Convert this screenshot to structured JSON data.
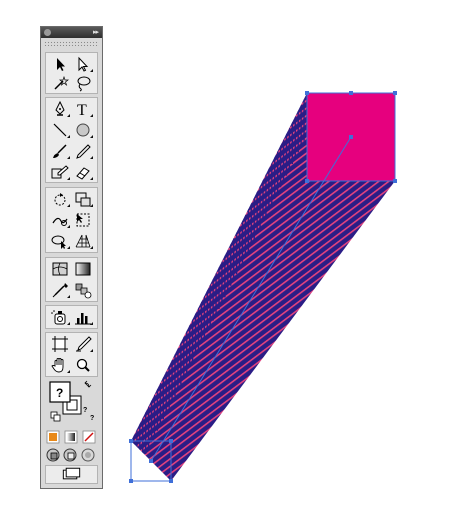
{
  "toolbar": {
    "collapse_glyph": "▸▸",
    "tools": [
      {
        "name": "selection-tool",
        "icon": "selection-arrow-icon"
      },
      {
        "name": "direct-selection-tool",
        "icon": "direct-selection-arrow-icon"
      },
      {
        "name": "magic-wand-tool",
        "icon": "magic-wand-icon"
      },
      {
        "name": "lasso-tool",
        "icon": "lasso-icon"
      },
      {
        "name": "pen-tool",
        "icon": "pen-icon"
      },
      {
        "name": "type-tool",
        "icon": "type-icon",
        "glyph": "T"
      },
      {
        "name": "line-segment-tool",
        "icon": "line-segment-icon"
      },
      {
        "name": "ellipse-tool",
        "icon": "ellipse-icon"
      },
      {
        "name": "paintbrush-tool",
        "icon": "paintbrush-icon"
      },
      {
        "name": "pencil-tool",
        "icon": "pencil-icon"
      },
      {
        "name": "blob-brush-tool",
        "icon": "blob-brush-icon"
      },
      {
        "name": "eraser-tool",
        "icon": "eraser-icon"
      },
      {
        "name": "rotate-tool",
        "icon": "rotate-icon"
      },
      {
        "name": "scale-tool",
        "icon": "scale-icon"
      },
      {
        "name": "warp-tool",
        "icon": "warp-icon"
      },
      {
        "name": "free-transform-tool",
        "icon": "free-transform-icon"
      },
      {
        "name": "shape-builder-tool",
        "icon": "shape-builder-icon"
      },
      {
        "name": "perspective-grid-tool",
        "icon": "perspective-grid-icon"
      },
      {
        "name": "mesh-tool",
        "icon": "mesh-icon"
      },
      {
        "name": "gradient-tool",
        "icon": "gradient-icon"
      },
      {
        "name": "eyedropper-tool",
        "icon": "eyedropper-icon"
      },
      {
        "name": "blend-tool",
        "icon": "blend-icon"
      },
      {
        "name": "symbol-sprayer-tool",
        "icon": "symbol-sprayer-icon"
      },
      {
        "name": "column-graph-tool",
        "icon": "column-graph-icon"
      },
      {
        "name": "artboard-tool",
        "icon": "artboard-icon"
      },
      {
        "name": "slice-tool",
        "icon": "slice-icon"
      },
      {
        "name": "hand-tool",
        "icon": "hand-icon"
      },
      {
        "name": "zoom-tool",
        "icon": "zoom-icon"
      }
    ],
    "fill_stroke": {
      "fill_glyph": "?",
      "stroke_glyph": "?",
      "default_glyph": "?"
    },
    "color_modes": [
      "color-mode-icon",
      "gradient-mode-icon",
      "none-mode-icon"
    ],
    "draw_modes": [
      "draw-normal-icon",
      "draw-behind-icon",
      "draw-inside-icon"
    ],
    "screen_mode": "screen-mode-icon"
  },
  "colors": {
    "square_fill": "#e6007e",
    "extrude_stroke": "#2a1d86",
    "extrude_stripe": "#e2427e",
    "selection": "#3f6fd8",
    "color_swatch": "#e8891a"
  }
}
